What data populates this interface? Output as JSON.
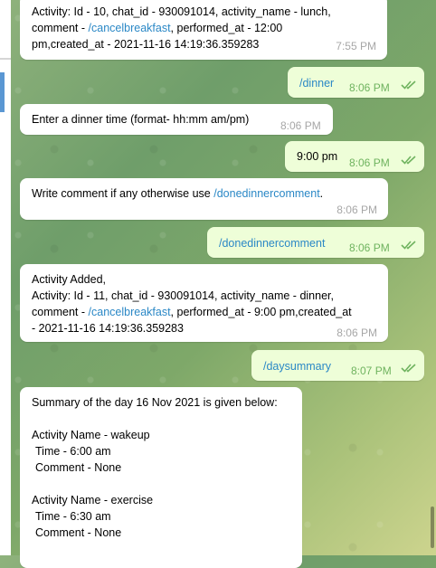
{
  "messages": {
    "m1": {
      "lines": [
        "Activity: Id - 10,  chat_id - 930091014, activity_name - lunch,",
        "comment - ",
        "/cancelbreakfast",
        ", performed_at - 12:00",
        "pm,created_at - 2021-11-16 14:19:36.359283"
      ],
      "time": "7:55 PM"
    },
    "m2": {
      "text": "/dinner",
      "time": "8:06 PM"
    },
    "m3": {
      "text": "Enter a dinner time (format- hh:mm am/pm)",
      "time": "8:06 PM"
    },
    "m4": {
      "text": "9:00 pm",
      "time": "8:06 PM"
    },
    "m5": {
      "prefix": "Write comment if any otherwise use ",
      "link": "/donedinnercomment",
      "suffix": ".",
      "time": "8:06 PM"
    },
    "m6": {
      "text": "/donedinnercomment",
      "time": "8:06 PM"
    },
    "m7": {
      "l1": "Activity Added,",
      "l2": "Activity: Id - 11,  chat_id - 930091014, activity_name - dinner,",
      "l3a": "comment - ",
      "l3link": "/cancelbreakfast",
      "l3b": ", performed_at - 9:00 pm,created_at",
      "l4": "- 2021-11-16 14:19:36.359283",
      "time": "8:06 PM"
    },
    "m8": {
      "text": "/daysummary",
      "time": "8:07 PM"
    },
    "m9": {
      "title": "Summary of the day 16 Nov 2021 is given below:",
      "a1_name": "Activity Name - wakeup",
      "a1_time": "Time - 6:00 am",
      "a1_comment": "Comment - None",
      "a2_name": "Activity Name - exercise",
      "a2_time": "Time - 6:30 am",
      "a2_comment": "Comment - None"
    }
  },
  "colors": {
    "incoming_bubble": "#ffffff",
    "outgoing_bubble": "#eefed8",
    "link": "#2b88c6",
    "read_check": "#6fb35f"
  },
  "icons": {
    "read_receipt": "double-check-icon"
  }
}
